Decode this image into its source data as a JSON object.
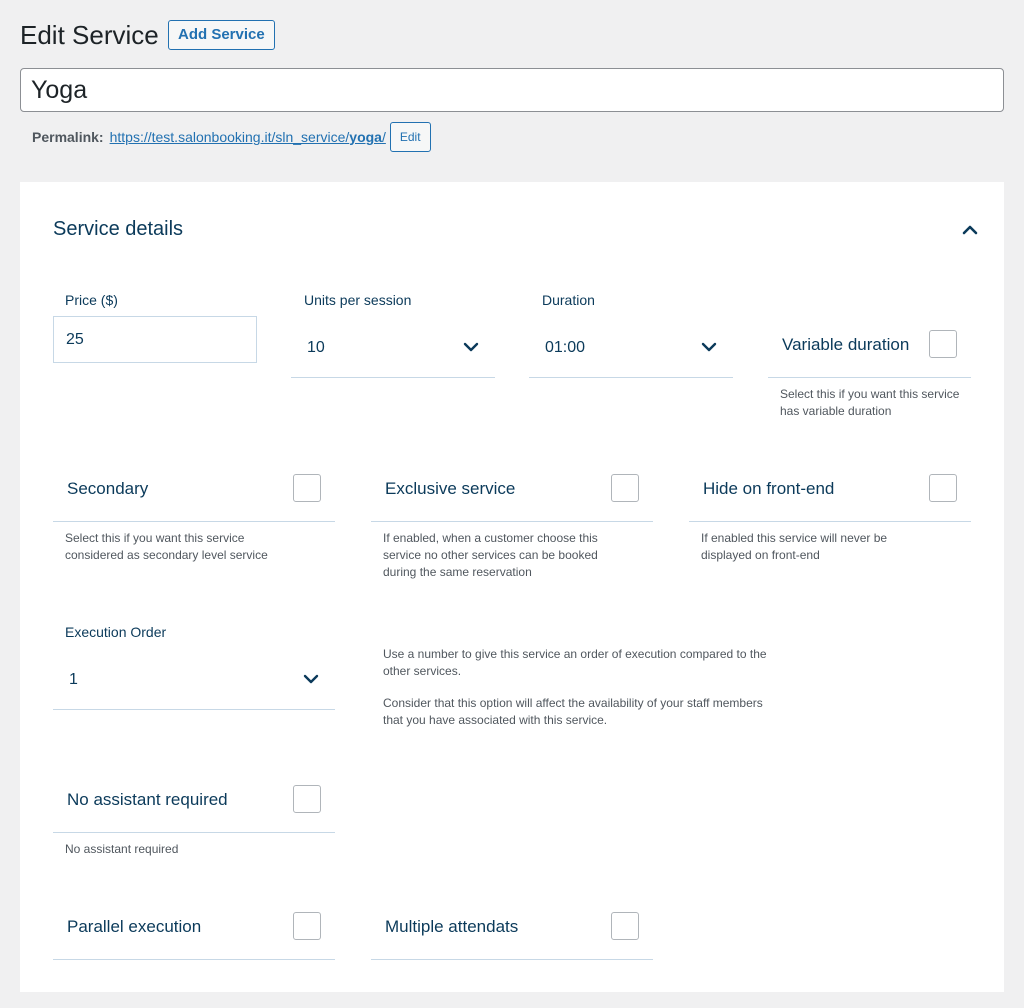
{
  "header": {
    "title": "Edit Service",
    "add_button": "Add Service"
  },
  "post_title": {
    "value": "Yoga"
  },
  "permalink": {
    "label": "Permalink:",
    "url_prefix": "https://test.salonbooking.it/sln_service/",
    "slug": "yoga",
    "url_suffix": "/",
    "edit_button": "Edit"
  },
  "panel": {
    "title": "Service details",
    "price": {
      "label": "Price ($)",
      "value": "25"
    },
    "units": {
      "label": "Units per session",
      "value": "10"
    },
    "duration": {
      "label": "Duration",
      "value": "01:00"
    },
    "variable_duration": {
      "label": "Variable duration",
      "help": "Select this if you want this service has variable duration",
      "checked": false
    },
    "secondary": {
      "label": "Secondary",
      "help": "Select this if you want this service considered as secondary level service",
      "checked": false
    },
    "exclusive": {
      "label": "Exclusive service",
      "help": "If enabled, when a customer choose this service no other services can be booked during the same reservation",
      "checked": false
    },
    "hide_frontend": {
      "label": "Hide on front-end",
      "help": "If enabled this service will never be displayed on front-end",
      "checked": false
    },
    "execution_order": {
      "label": "Execution Order",
      "value": "1",
      "help1": "Use a number to give this service an order of execution compared to the other services.",
      "help2": "Consider that this option will affect the availability of your staff members that you have associated with this service."
    },
    "no_assistant": {
      "label": "No assistant required",
      "help": "No assistant required",
      "checked": false
    },
    "parallel": {
      "label": "Parallel execution",
      "checked": false
    },
    "multiple_attendants": {
      "label": "Multiple attendats",
      "checked": false
    }
  },
  "colors": {
    "accent": "#2271b1",
    "text_dark_blue": "#0b3a5a",
    "background": "#f0f0f1"
  }
}
